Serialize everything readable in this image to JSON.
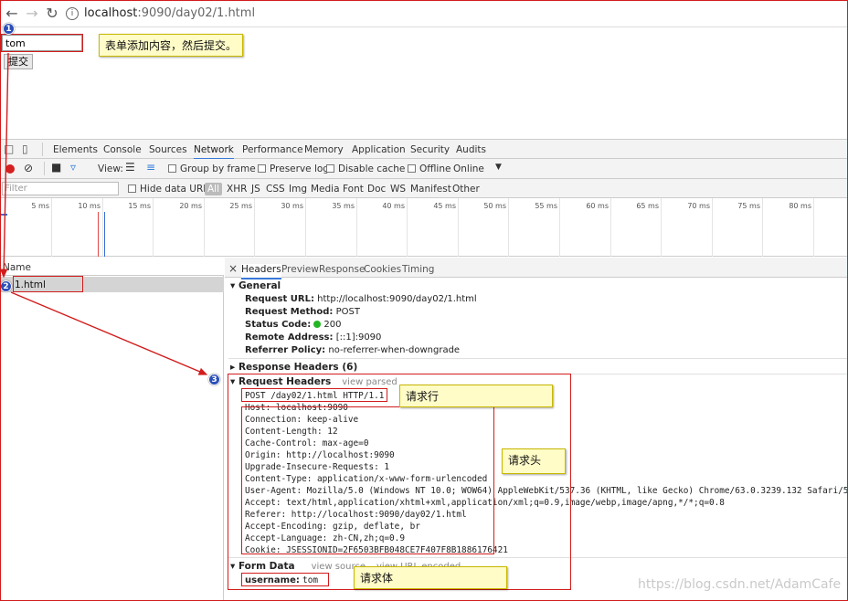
{
  "browser": {
    "url_host": "localhost",
    "url_rest": ":9090/day02/1.html",
    "info_glyph": "i"
  },
  "page": {
    "text_input_value": "tom",
    "submit_label": "提交"
  },
  "notes": {
    "note1": "表单添加内容，然后提交。",
    "note_line": "请求行",
    "note_head": "请求头",
    "note_body": "请求体"
  },
  "badges": [
    "1",
    "2",
    "3"
  ],
  "devtools": {
    "tabs": [
      "Elements",
      "Console",
      "Sources",
      "Network",
      "Performance",
      "Memory",
      "Application",
      "Security",
      "Audits"
    ],
    "active_tab": "Network",
    "toolbar": {
      "view_label": "View:",
      "group_by_frame": "Group by frame",
      "preserve_log": "Preserve log",
      "disable_cache": "Disable cache",
      "offline": "Offline",
      "online": "Online"
    },
    "filter": {
      "placeholder": "Filter",
      "hide_data_urls": "Hide data URLs",
      "types": [
        "All",
        "XHR",
        "JS",
        "CSS",
        "Img",
        "Media",
        "Font",
        "Doc",
        "WS",
        "Manifest",
        "Other"
      ]
    },
    "timeline_ticks": [
      "5 ms",
      "10 ms",
      "15 ms",
      "20 ms",
      "25 ms",
      "30 ms",
      "35 ms",
      "40 ms",
      "45 ms",
      "50 ms",
      "55 ms",
      "60 ms",
      "65 ms",
      "70 ms",
      "75 ms",
      "80 ms"
    ],
    "name_header": "Name",
    "request_name": "1.html",
    "detail_tabs": [
      "Headers",
      "Preview",
      "Response",
      "Cookies",
      "Timing"
    ],
    "active_detail_tab": "Headers",
    "general": {
      "title": "General",
      "request_url_k": "Request URL:",
      "request_url_v": "http://localhost:9090/day02/1.html",
      "request_method_k": "Request Method:",
      "request_method_v": "POST",
      "status_code_k": "Status Code:",
      "status_code_v": "200",
      "remote_address_k": "Remote Address:",
      "remote_address_v": "[::1]:9090",
      "referrer_policy_k": "Referrer Policy:",
      "referrer_policy_v": "no-referrer-when-downgrade"
    },
    "response_headers_title": "Response Headers (6)",
    "request_headers": {
      "title": "Request Headers",
      "view_parsed": "view parsed",
      "request_line": "POST /day02/1.html HTTP/1.1",
      "lines": [
        "Host: localhost:9090",
        "Connection: keep-alive",
        "Content-Length: 12",
        "Cache-Control: max-age=0",
        "Origin: http://localhost:9090",
        "Upgrade-Insecure-Requests: 1",
        "Content-Type: application/x-www-form-urlencoded",
        "User-Agent: Mozilla/5.0 (Windows NT 10.0; WOW64) AppleWebKit/537.36 (KHTML, like Gecko) Chrome/63.0.3239.132 Safari/537.36",
        "Accept: text/html,application/xhtml+xml,application/xml;q=0.9,image/webp,image/apng,*/*;q=0.8",
        "Referer: http://localhost:9090/day02/1.html",
        "Accept-Encoding: gzip, deflate, br",
        "Accept-Language: zh-CN,zh;q=0.9",
        "Cookie: JSESSIONID=2F6503BFB048CE7F407F8B1886176421"
      ]
    },
    "form_data": {
      "title": "Form Data",
      "view_source": "view source",
      "view_url_encoded": "view URL encoded",
      "key": "username:",
      "value": "tom"
    }
  },
  "watermark": "https://blog.csdn.net/AdamCafe"
}
